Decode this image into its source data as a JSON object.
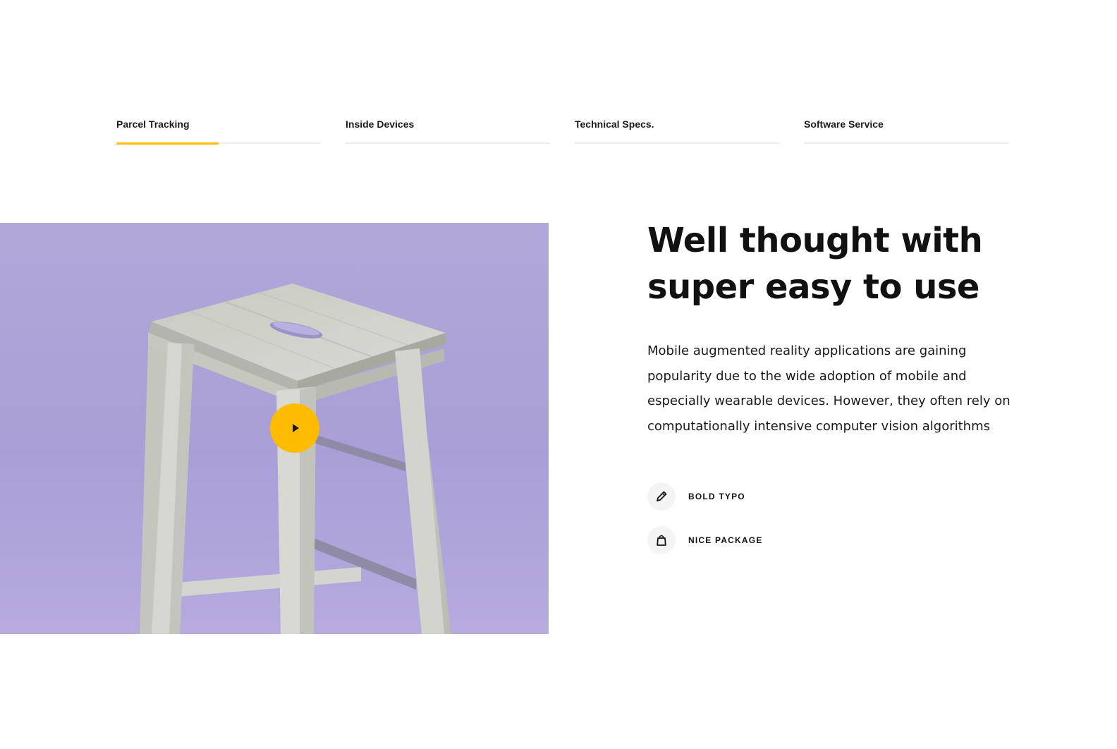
{
  "tabs": [
    {
      "label": "Parcel Tracking",
      "active": true,
      "progress": 0.5
    },
    {
      "label": "Inside Devices",
      "active": false,
      "progress": 0
    },
    {
      "label": "Technical Specs.",
      "active": false,
      "progress": 0
    },
    {
      "label": "Software Service",
      "active": false,
      "progress": 0
    }
  ],
  "media": {
    "play_icon": "play-icon"
  },
  "content": {
    "heading": "Well thought with super easy to use",
    "description": "Mobile augmented reality applications are gaining popularity due to the wide adoption of mobile and especially wearable devices. However, they often rely on computationally intensive computer vision algorithms",
    "features": [
      {
        "icon": "pencil-icon",
        "label": "BOLD TYPO"
      },
      {
        "icon": "shopping-bag-icon",
        "label": "NICE PACKAGE"
      }
    ]
  },
  "colors": {
    "accent": "#ffbb00",
    "media_bg": "#ada3d7",
    "text": "#111111",
    "track": "#ececec"
  }
}
